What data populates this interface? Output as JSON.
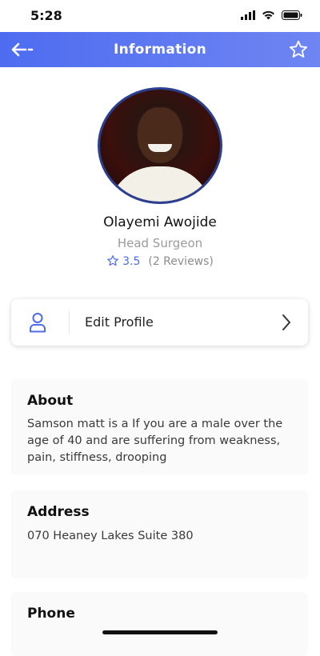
{
  "status_bar": {
    "time": "5:28"
  },
  "header": {
    "title": "Information"
  },
  "profile": {
    "name": "Olayemi Awojide",
    "role": "Head Surgeon",
    "rating": "3.5",
    "reviews": "(2 Reviews)"
  },
  "edit_profile": {
    "label": "Edit Profile"
  },
  "about": {
    "title": "About",
    "text": "Samson matt is a If you are a male over the age of 40 and are suffering from weakness, pain, stiffness, drooping"
  },
  "address": {
    "title": "Address",
    "text": "070 Heaney Lakes Suite 380"
  },
  "phone": {
    "title": "Phone"
  },
  "colors": {
    "accent": "#4d6cf0",
    "accent_dark": "#2b3f91"
  },
  "icons": [
    "back-arrow-icon",
    "star-outline-icon",
    "user-icon",
    "chevron-right-icon",
    "signal-icon",
    "wifi-icon",
    "battery-icon"
  ]
}
